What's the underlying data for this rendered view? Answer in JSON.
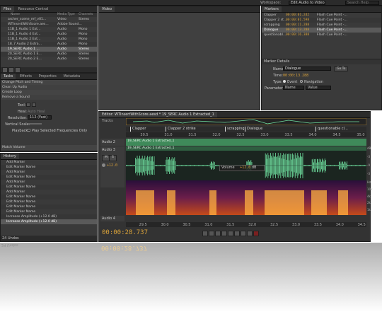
{
  "top_bar": {
    "workspace_label": "Workspace:",
    "workspace_value": "Edit Audio to Video",
    "search_placeholder": "Search Help"
  },
  "files_panel": {
    "tabs": [
      "Files",
      "Resource Central"
    ],
    "columns": [
      "Name",
      "Media Type",
      "Channels"
    ],
    "rows": [
      {
        "name": "archer_scene_ref_v01...",
        "type": "Video",
        "ch": "Stereo"
      },
      {
        "name": "WTInsertWithScore.aes...",
        "type": "Adobe Sound...",
        "ch": ""
      },
      {
        "name": "11B_1 Audio 1 Ext...",
        "type": "Audio",
        "ch": "Mono"
      },
      {
        "name": "11B_1 Audio 4 Ext...",
        "type": "Audio",
        "ch": "Mono"
      },
      {
        "name": "11B_1 Audio 2 Ext...",
        "type": "Audio",
        "ch": "Mono"
      },
      {
        "name": "18_7 Audio 2 Extra...",
        "type": "Audio",
        "ch": "Mono"
      },
      {
        "name": "19_SERC Audio 1 ...",
        "type": "Audio",
        "ch": "Stereo"
      },
      {
        "name": "20_SERC Audio 1 E...",
        "type": "Audio",
        "ch": "Stereo"
      },
      {
        "name": "20_SERC Audio 2 E...",
        "type": "Audio",
        "ch": "Stereo"
      }
    ]
  },
  "effects_panel": {
    "tabs": [
      "Tasks",
      "Effects",
      "Properties",
      "Metadata"
    ],
    "items": [
      "Change Pitch and Timing",
      "Clean Up Audio",
      "Create Loop",
      "Remove a Sound"
    ],
    "tool_label": "Tool:",
    "heal_label": "Heal:",
    "heal_value": "Auto Heal",
    "resolution_label": "Resolution:",
    "resolution_value": "112 (Fast)",
    "vscale_label": "Vertical Scale:",
    "playback_label": "Playback:",
    "playback_option": "Play Selected Frequencies Only",
    "match_volume": "Match Volume"
  },
  "history_panel": {
    "title": "History",
    "items": [
      "Add Marker",
      "Edit Marker Name",
      "Add Marker",
      "Edit Marker Name",
      "Add Marker",
      "Edit Marker Name",
      "Add Marker",
      "Edit Marker Name",
      "Edit Marker Name",
      "Edit Marker Name",
      "Edit Marker Name",
      "Increase Amplitude (+12.0 dB)",
      "Increase Amplitude (+12.0 dB)"
    ],
    "undo_count": "24 Undos"
  },
  "video_panel": {
    "title": "Video"
  },
  "markers_panel": {
    "title": "Markers",
    "rows": [
      {
        "name": "Clapper",
        "time": "00:00:01.242",
        "type": "Flash Cue Point -..."
      },
      {
        "name": "Clapper 2 st...",
        "time": "00:00:01.598",
        "type": "Flash Cue Point -..."
      },
      {
        "name": "scrapping",
        "time": "00:00:11.288",
        "type": "Flash Cue Point -..."
      },
      {
        "name": "Dialogue",
        "time": "00:00:13.288",
        "type": "Flash Cue Point -..."
      },
      {
        "name": "questionabl...",
        "time": "00:00:16.388",
        "type": "Flash Cue Point -..."
      }
    ],
    "details_title": "Marker Details",
    "name_label": "Name:",
    "name_value": "Dialogue",
    "goto_label": "Go To",
    "time_label": "Time:",
    "time_value": "00:00:13.288",
    "type_label": "Type:",
    "type_event": "Event",
    "type_nav": "Navigation",
    "params_label": "Parameters:",
    "params_name": "Name",
    "params_value": "Value"
  },
  "editor": {
    "title": "Editor: WTInsertWithScore.aesd * 19_SERC Audio 1 Extracted_1",
    "tracks_label": "Tracks",
    "markers": [
      "Clapper",
      "Clapper 2 strike",
      "scrapping",
      "Dialogue",
      "questionable cl..."
    ],
    "ruler_top": [
      "30.5",
      "31.0",
      "31.5",
      "32.0",
      "32.5",
      "33.0",
      "33.5",
      "34.0",
      "34.5",
      "35.0"
    ],
    "tracks": [
      {
        "name": "Audio 2",
        "clip": "19_SERC Audio 1 Extracted_1"
      },
      {
        "name": "Audio 3",
        "clip": "19_SERC Audio 1 Extracted_1"
      },
      {
        "name": "Audio 4",
        "clip": ""
      }
    ],
    "volume_label": "Volume",
    "volume_value": "+12.0",
    "db_label": "dB",
    "mute_label": "M",
    "solo_label": "S",
    "ruler_bottom": [
      "29.5",
      "30.0",
      "30.5",
      "31.0",
      "31.5",
      "32.0",
      "32.5",
      "33.0",
      "33.5",
      "34.0",
      "34.5"
    ],
    "db_scale": [
      "dB",
      "-3",
      "-9",
      "-3"
    ],
    "hz_scale": [
      "Hz",
      "10k",
      "4k",
      "2k",
      "1k"
    ],
    "timecode": "00:00:28.737",
    "timecode_reflect": "00:00:28.737"
  },
  "colors": {
    "bg": "#3a3a3a",
    "panel_dark": "#2b2b2b",
    "accent_gold": "#d9a23a",
    "wave_green": "#6fe0a0",
    "clip_green": "#3f8a5a",
    "track_bg": "#1e2a24"
  }
}
